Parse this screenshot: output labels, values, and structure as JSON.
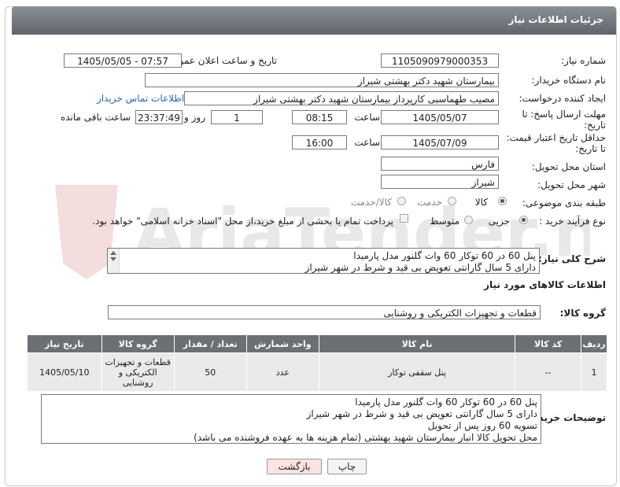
{
  "header": {
    "title": "جزئیات اطلاعات نیاز"
  },
  "form": {
    "need_number": {
      "label": "شماره نیاز:",
      "value": "1105090979000353"
    },
    "announce_datetime": {
      "label": "تاریخ و ساعت اعلان عمومی:",
      "value": "1405/05/05 - 07:57"
    },
    "buyer_org": {
      "label": "نام دستگاه خریدار:",
      "value": "بیمارستان شهید دکتر بهشتی شیراز"
    },
    "requester": {
      "label": "ایجاد کننده درخواست:",
      "value": "مصیب طهماسبی کارپرداز بیمارستان شهید دکتر بهشتی شیراز",
      "contact_link": "اطلاعات تماس خریدار"
    },
    "reply_deadline": {
      "label_line1": "مهلت ارسال پاسخ: تا",
      "label_line2": "تاریخ:",
      "date": "1405/05/07",
      "time_label": "ساعت",
      "time": "08:15",
      "days": "1",
      "days_label": "روز و",
      "remaining": "23:37:49",
      "remaining_label": "ساعت باقی مانده"
    },
    "price_validity": {
      "label_line1": "حداقل تاریخ اعتبار قیمت:",
      "label_line2": "تا تاریخ:",
      "date": "1405/07/09",
      "time_label": "ساعت",
      "time": "16:00"
    },
    "province": {
      "label": "استان محل تحویل:",
      "value": "فارس"
    },
    "city": {
      "label": "شهر محل تحویل:",
      "value": "شیراز"
    },
    "category": {
      "label": "طبقه بندی موضوعی:",
      "options": [
        "کالا",
        "خدمت",
        "کالا/خدمت"
      ],
      "selected": "کالا"
    },
    "process_type": {
      "label": "نوع فرآیند خرید :",
      "options": [
        "جزیی",
        "متوسط"
      ],
      "selected": "جزیی",
      "payment_note": "پرداخت تمام یا بخشی از مبلغ خرید،از محل \"اسناد خزانه اسلامی\" خواهد بود."
    },
    "description": {
      "label": "شرح کلی نیاز:",
      "lines": [
        "پنل 60 در 60 توکار 60 وات گلنور مدل پارمیدا",
        "دارای 5 سال گارانتی تعویض بی قید و شرط در شهر شیراز"
      ]
    }
  },
  "goods_section": {
    "title": "اطلاعات کالاهای مورد نیاز",
    "group_label": "گروه کالا:",
    "group_value": "قطعات و تجهیزات الکتریکی و روشنایی",
    "table": {
      "headers": [
        "ردیف",
        "کد کالا",
        "نام کالا",
        "واحد شمارش",
        "تعداد / مقدار",
        "گروه کالا",
        "تاریخ نیاز"
      ],
      "rows": [
        {
          "row": "1",
          "code": "--",
          "name": "پنل سقفی توکار",
          "unit": "عدد",
          "qty": "50",
          "group": "قطعات و تجهیزات الکتریکی و روشنایی",
          "date": "1405/05/10"
        }
      ]
    }
  },
  "buyer_notes": {
    "label": "توضیحات خریدار:",
    "lines": [
      "پنل 60 در 60 توکار 60 وات گلنور مدل پارمیدا",
      "دارای 5 سال گارانتی تعویض بی قید و شرط در شهر شیراز",
      "تسویه 60 روز پس از تحویل",
      "محل تحویل کالا انبار بیمارستان شهید بهشتی (تمام هزینه ها به عهده فروشنده می باشد)"
    ]
  },
  "buttons": {
    "print": "چاپ",
    "back": "بازگشت"
  },
  "watermark": "AriaTender.net",
  "colors": {
    "header": "#6b7075",
    "link": "#2a6ab0",
    "back_button": "#fbe3e3"
  }
}
